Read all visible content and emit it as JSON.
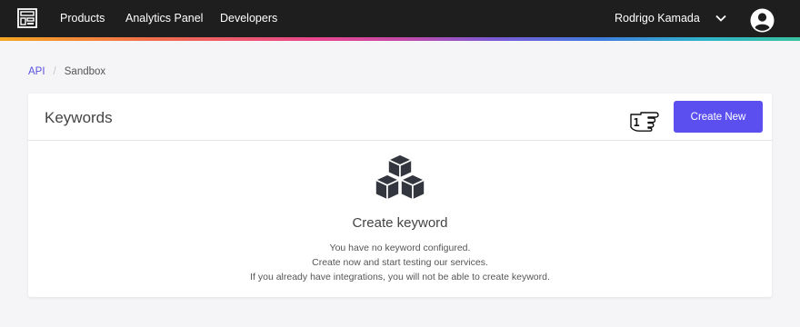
{
  "nav": {
    "items": [
      "Products",
      "Analytics Panel",
      "Developers"
    ],
    "user_name": "Rodrigo Kamada",
    "icons": {
      "logo": "building-logo-icon",
      "chevron": "chevron-down-icon",
      "avatar": "user-avatar-icon"
    }
  },
  "breadcrumb": {
    "items": [
      "API",
      "Sandbox"
    ]
  },
  "card": {
    "title": "Keywords",
    "create_button": "Create New",
    "pointer_badge": "1",
    "empty_title": "Create keyword",
    "empty_lines": [
      "You have no keyword configured.",
      "Create now and start testing our services.",
      "If you already have integrations, you will not be able to create keyword."
    ]
  },
  "colors": {
    "accent": "#5b50ef",
    "topbar": "#1e1e1e",
    "link": "#5a52e0"
  }
}
